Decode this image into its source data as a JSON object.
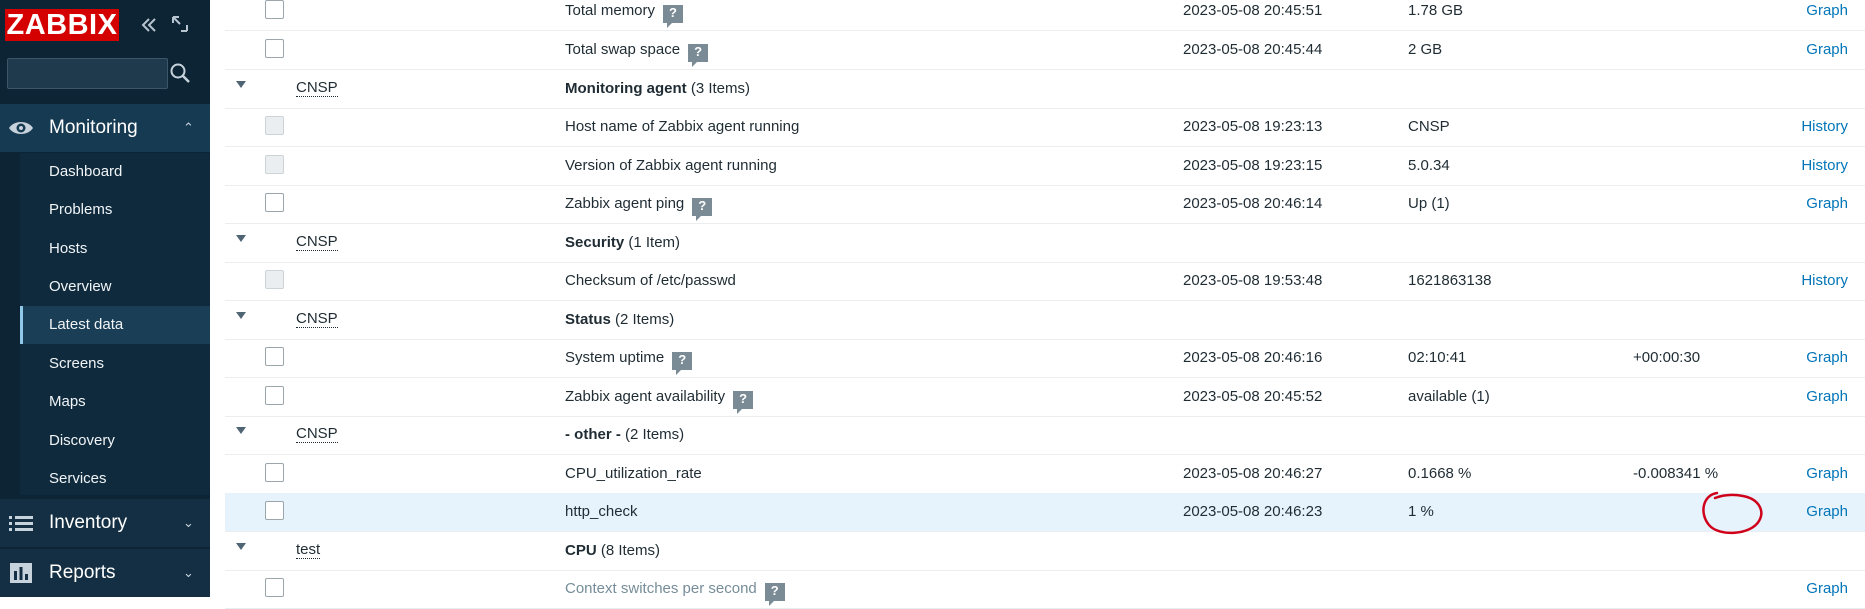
{
  "app": {
    "logo": "ZABBIX",
    "search_placeholder": ""
  },
  "nav": {
    "monitoring": {
      "label": "Monitoring",
      "items": [
        "Dashboard",
        "Problems",
        "Hosts",
        "Overview",
        "Latest data",
        "Screens",
        "Maps",
        "Discovery",
        "Services"
      ],
      "selected": "Latest data"
    },
    "inventory": {
      "label": "Inventory"
    },
    "reports": {
      "label": "Reports"
    }
  },
  "rows": [
    {
      "type": "item",
      "name": "Total memory",
      "help": true,
      "time": "2023-05-08 20:45:51",
      "value": "1.78 GB",
      "change": "",
      "action": "Graph"
    },
    {
      "type": "item",
      "name": "Total swap space",
      "help": true,
      "time": "2023-05-08 20:45:44",
      "value": "2 GB",
      "change": "",
      "action": "Graph"
    },
    {
      "type": "group",
      "host": "CNSP",
      "app": "Monitoring agent",
      "count": "(3 Items)"
    },
    {
      "type": "item",
      "disabled": true,
      "name": "Host name of Zabbix agent running",
      "help": false,
      "time": "2023-05-08 19:23:13",
      "value": "CNSP",
      "change": "",
      "action": "History"
    },
    {
      "type": "item",
      "disabled": true,
      "name": "Version of Zabbix agent running",
      "help": false,
      "time": "2023-05-08 19:23:15",
      "value": "5.0.34",
      "change": "",
      "action": "History"
    },
    {
      "type": "item",
      "name": "Zabbix agent ping",
      "help": true,
      "time": "2023-05-08 20:46:14",
      "value": "Up (1)",
      "change": "",
      "action": "Graph"
    },
    {
      "type": "group",
      "host": "CNSP",
      "app": "Security",
      "count": "(1 Item)"
    },
    {
      "type": "item",
      "disabled": true,
      "name": "Checksum of /etc/passwd",
      "help": false,
      "time": "2023-05-08 19:53:48",
      "value": "1621863138",
      "change": "",
      "action": "History"
    },
    {
      "type": "group",
      "host": "CNSP",
      "app": "Status",
      "count": "(2 Items)"
    },
    {
      "type": "item",
      "name": "System uptime",
      "help": true,
      "time": "2023-05-08 20:46:16",
      "value": "02:10:41",
      "change": "+00:00:30",
      "action": "Graph"
    },
    {
      "type": "item",
      "name": "Zabbix agent availability",
      "help": true,
      "time": "2023-05-08 20:45:52",
      "value": "available (1)",
      "change": "",
      "action": "Graph"
    },
    {
      "type": "group",
      "host": "CNSP",
      "app": "- other -",
      "count": "(2 Items)"
    },
    {
      "type": "item",
      "name": "CPU_utilization_rate",
      "help": false,
      "time": "2023-05-08 20:46:27",
      "value": "0.1668 %",
      "change": "-0.008341 %",
      "action": "Graph"
    },
    {
      "type": "item",
      "name": "http_check",
      "help": false,
      "highlight": true,
      "time": "2023-05-08 20:46:23",
      "value": "1 %",
      "change": "",
      "action": "Graph"
    },
    {
      "type": "group",
      "host": "test",
      "app": "CPU",
      "count": "(8 Items)"
    },
    {
      "type": "item",
      "muted": true,
      "name": "Context switches per second",
      "help": true,
      "time": "",
      "value": "",
      "change": "",
      "action": "Graph"
    }
  ],
  "help_glyph": "?",
  "colors": {
    "sidebar": "#0d2435",
    "logo": "#d40000",
    "link": "#0275b8",
    "highlight": "#e6f3fc",
    "annotation": "#d0021b"
  }
}
